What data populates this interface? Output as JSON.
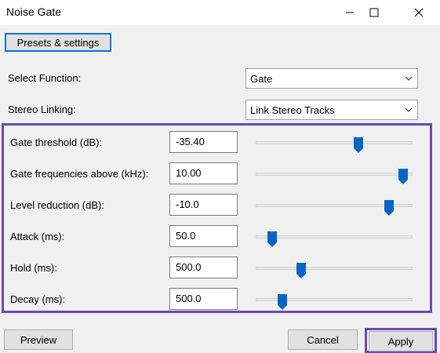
{
  "window": {
    "title": "Noise Gate"
  },
  "titlebar_icons": {
    "minimize": "minimize-icon",
    "maximize": "maximize-icon",
    "close": "close-icon"
  },
  "presets_button": "Presets & settings",
  "select_function": {
    "label": "Select Function:",
    "value": "Gate"
  },
  "stereo_linking": {
    "label": "Stereo Linking:",
    "value": "Link Stereo Tracks"
  },
  "params": [
    {
      "label": "Gate threshold (dB):",
      "value": "-35.40",
      "slider_fraction": 0.66
    },
    {
      "label": "Gate frequencies above (kHz):",
      "value": "10.00",
      "slider_fraction": 0.97
    },
    {
      "label": "Level reduction (dB):",
      "value": "-10.0",
      "slider_fraction": 0.87
    },
    {
      "label": "Attack (ms):",
      "value": "50.0",
      "slider_fraction": 0.07
    },
    {
      "label": "Hold (ms):",
      "value": "500.0",
      "slider_fraction": 0.27
    },
    {
      "label": "Decay (ms):",
      "value": "500.0",
      "slider_fraction": 0.14
    }
  ],
  "buttons": {
    "preview": "Preview",
    "cancel": "Cancel",
    "apply": "Apply"
  },
  "colors": {
    "accent": "#0078d7",
    "highlight": "#6648bd",
    "thumb": "#0a64c8"
  }
}
